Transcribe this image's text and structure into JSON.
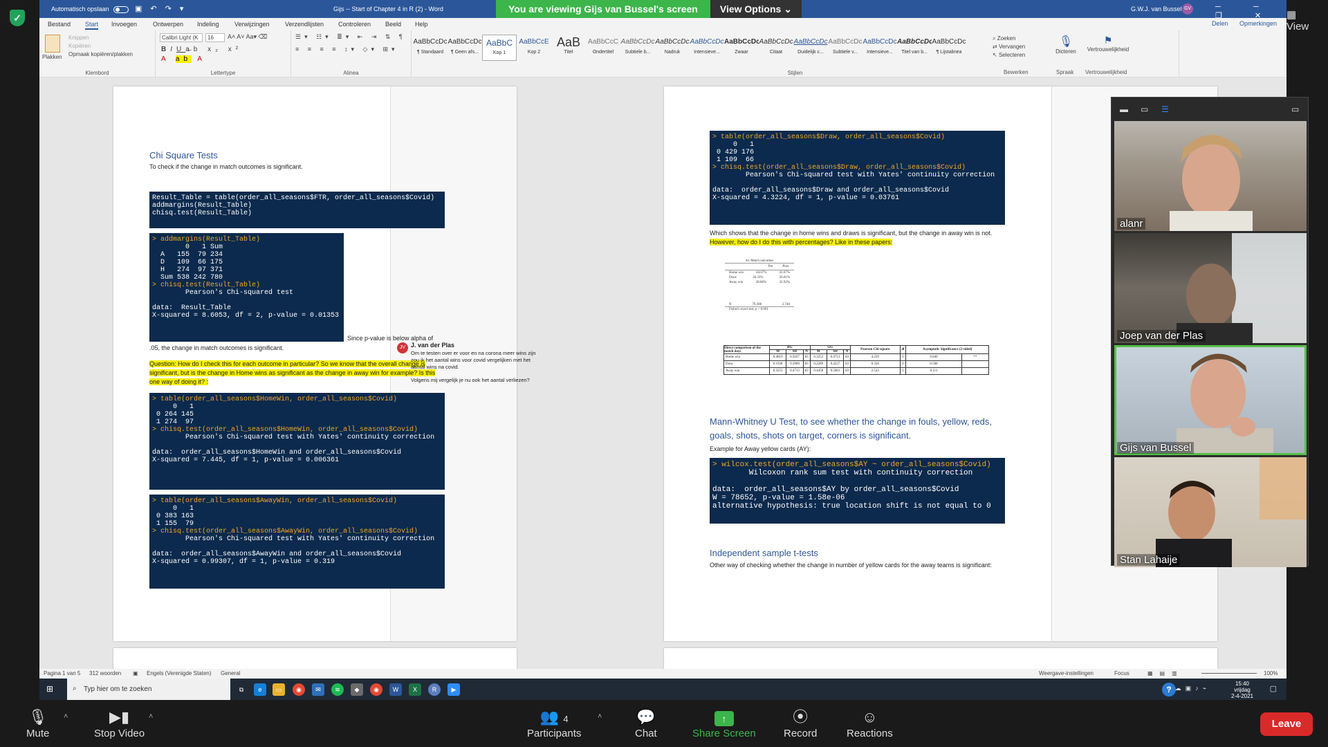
{
  "zoom": {
    "view_label": "View",
    "banner_text": "You are viewing Gijs van Bussel's screen",
    "view_options": "View Options",
    "bottom": {
      "mute": "Mute",
      "stop_video": "Stop Video",
      "participants": "Participants",
      "participant_count": "4",
      "chat": "Chat",
      "share_screen": "Share Screen",
      "record": "Record",
      "reactions": "Reactions",
      "leave": "Leave"
    },
    "participants": [
      "alanr",
      "Joep van der Plas",
      "Gijs van Bussel",
      "Stan Lahaije"
    ]
  },
  "word": {
    "autosave": "Automatisch opslaan",
    "title": "Gijs -- Start of Chapter 4 in R (2)  -  Word",
    "user": "G.W.J. van Bussel",
    "user_initials": "GV",
    "tabs": [
      "Bestand",
      "Start",
      "Invoegen",
      "Ontwerpen",
      "Indeling",
      "Verwijzingen",
      "Verzendlijsten",
      "Controleren",
      "Beeld",
      "Help"
    ],
    "active_tab": "Start",
    "share": "Delen",
    "comments": "Opmerkingen",
    "ribbon": {
      "paste": "Plakken",
      "cut": "Knippen",
      "copy": "Kopiëren",
      "format_painter": "Opmaak kopiëren/plakken",
      "clipboard": "Klembord",
      "font_name": "Calibri Light (K",
      "font_size": "16",
      "font_group": "Lettertype",
      "paragraph": "Alinea",
      "styles_group": "Stijlen",
      "styles": [
        {
          "sample": "AaBbCcDc",
          "name": "¶ Standaard"
        },
        {
          "sample": "AaBbCcDc",
          "name": "¶ Geen afs..."
        },
        {
          "sample": "AaBbC",
          "name": "Kop 1"
        },
        {
          "sample": "AaBbCcE",
          "name": "Kop 2"
        },
        {
          "sample": "AaB",
          "name": "Titel"
        },
        {
          "sample": "AaBbCcC",
          "name": "Ondertitel"
        },
        {
          "sample": "AaBbCcDc",
          "name": "Subtiele b..."
        },
        {
          "sample": "AaBbCcDc",
          "name": "Nadruk"
        },
        {
          "sample": "AaBbCcDc",
          "name": "Intensieve..."
        },
        {
          "sample": "AaBbCcDc",
          "name": "Zwaar"
        },
        {
          "sample": "AaBbCcDc",
          "name": "Citaat"
        },
        {
          "sample": "AaBbCcDc",
          "name": "Duidelijk c..."
        },
        {
          "sample": "AaBbCcDc",
          "name": "Subtiele v..."
        },
        {
          "sample": "AaBbCcDc",
          "name": "Intensieve..."
        },
        {
          "sample": "AaBbCcDc",
          "name": "Titel van b..."
        },
        {
          "sample": "AaBbCcDc",
          "name": "¶ Lijstalinea"
        }
      ],
      "find": "Zoeken",
      "replace": "Vervangen",
      "select": "Selecteren",
      "edit_group": "Bewerken",
      "dictate": "Dicteren",
      "speech_group": "Spraak",
      "sensitivity": "Vertrouwelijkheid",
      "sensitivity_group": "Vertrouwelijkheid"
    },
    "status": {
      "page": "Pagina 1 van 5",
      "words": "312 woorden",
      "language": "Engels (Verenigde Staten)",
      "general": "General",
      "display_settings": "Weergave-instellingen",
      "focus": "Focus",
      "zoom": "100%"
    }
  },
  "doc": {
    "left": {
      "heading": "Chi Square Tests",
      "intro": "To check if the change in match outcomes is significant.",
      "code1": "Result_Table = table(order_all_seasons$FTR, order_all_seasons$Covid)\naddmargins(Result_Table)\nchisq.test(Result_Table)",
      "code2_cmd1": "> addmargins(Result_Table)",
      "code2_body": "\n        0   1 Sum\n  A   155  79 234\n  D   109  66 175\n  H   274  97 371\n  Sum 538 242 780",
      "code2_cmd2": "> chisq.test(Result_Table)",
      "code2_tail": "\n        Pearson's Chi-squared test\n\ndata:  Result_Table\nX-squared = 8.6053, df = 2, p-value = 0.01353",
      "after_code2_a": "Since p-value is below alpha of",
      "after_code2_b": ".05, the change in match outcomes is significant.",
      "question": "Question: How do I check this for each outcome in particular? So we know that the overall change is significant, but is the change in Home wins as significant as the change in away win for example? Is this one way of doing it? :",
      "code3_cmd1": "> table(order_all_seasons$HomeWin, order_all_seasons$Covid)",
      "code3_body": "\n     0   1\n 0 264 145\n 1 274  97",
      "code3_cmd2": "> chisq.test(order_all_seasons$HomeWin, order_all_seasons$Covid)",
      "code3_tail": "\n        Pearson's Chi-squared test with Yates' continuity correction\n\ndata:  order_all_seasons$HomeWin and order_all_seasons$Covid\nX-squared = 7.445, df = 1, p-value = 0.006361",
      "code4_cmd1": "> table(order_all_seasons$AwayWin, order_all_seasons$Covid)",
      "code4_body": "\n     0   1\n 0 383 163\n 1 155  79",
      "code4_cmd2": "> chisq.test(order_all_seasons$AwayWin, order_all_seasons$Covid)",
      "code4_tail": "\n        Pearson's Chi-squared test with Yates' continuity correction\n\ndata:  order_all_seasons$AwayWin and order_all_seasons$Covid\nX-squared = 0.99307, df = 1, p-value = 0.319"
    },
    "comment": {
      "initials": "JV",
      "author": "J. van der Plas",
      "text1": "Om te testen over er voor en na corona meer wins zijn zou ik het aantal wins voor covid vergelijken met het aantal wins na covid.",
      "text2": "Volgens mij vergelijk je nu ook het aantal verliezen?"
    },
    "right": {
      "code5_cmd1": "> table(order_all_seasons$Draw, order_all_seasons$Covid)",
      "code5_body": "\n     0   1\n 0 429 176\n 1 109  66",
      "code5_cmd2": "> chisq.test(order_all_seasons$Draw, order_all_seasons$Covid)",
      "code5_tail": "\n        Pearson's Chi-squared test with Yates' continuity correction\n\ndata:  order_all_seasons$Draw and order_all_seasons$Covid\nX-squared = 4.3224, df = 1, p-value = 0.03761",
      "para1": "Which shows that the change in home wins and draws is significant, but the change in away win is not.",
      "para1_hl": "However, how do I do this with percentages? Like in these papers:",
      "small_table_title": "A1 Match outcomes",
      "small_table_cols": [
        "Pre",
        "Post"
      ],
      "small_table_rows": [
        [
          "Home win",
          "44.67%",
          "41.67%"
        ],
        [
          "Draw",
          "26.33%",
          "26.01%"
        ],
        [
          "Away win",
          "28.86%",
          "32.92%"
        ]
      ],
      "small_table_n": [
        "N",
        "79,300",
        "2,740"
      ],
      "small_table_foot": "Fisher's exact test, p < 0.001",
      "big_table_head": [
        "Direct comparison of the match days",
        "RG",
        "GG",
        "Pearson Chi-square",
        "df",
        "Asymptotic Significance (2-sided)"
      ],
      "big_table_sub": [
        "M",
        "SD",
        "N",
        "M",
        "SD",
        "N"
      ],
      "big_table_rows": [
        [
          "Home win",
          "0.4819",
          "0.5027",
          "83",
          "0.3253",
          "0.4713",
          "83",
          "4.229",
          "1",
          "0.040",
          "**"
        ],
        [
          "Draw",
          "0.1928",
          "0.3969",
          "83",
          "0.2289",
          "0.4227",
          "83",
          "0.326",
          "1",
          "0.568",
          ""
        ],
        [
          "Away win",
          "0.3253",
          "0.4713",
          "83",
          "0.4458",
          "0.5001",
          "83",
          "2.543",
          "1",
          "0.111",
          ""
        ]
      ],
      "heading2": "Mann-Whitney U Test, to see whether the change in fouls, yellow, reds, goals, shots, shots on target, corners is significant.",
      "example": "Example for Away yellow cards (AY):",
      "code6_cmd": "> wilcox.test(order_all_seasons$AY ~ order_all_seasons$Covid)",
      "code6_tail": "\n        Wilcoxon rank sum test with continuity correction\n\ndata:  order_all_seasons$AY by order_all_seasons$Covid\nW = 78652, p-value = 1.58e-06\nalternative hypothesis: true location shift is not equal to 0",
      "heading3": "Independent sample t-tests",
      "para3": "Other way of checking whether the change in number of yellow cards for the away teams is significant:"
    }
  },
  "taskbar": {
    "search_placeholder": "Typ hier om te zoeken",
    "time": "15:40",
    "day": "vrijdag",
    "date": "2-4-2021"
  }
}
